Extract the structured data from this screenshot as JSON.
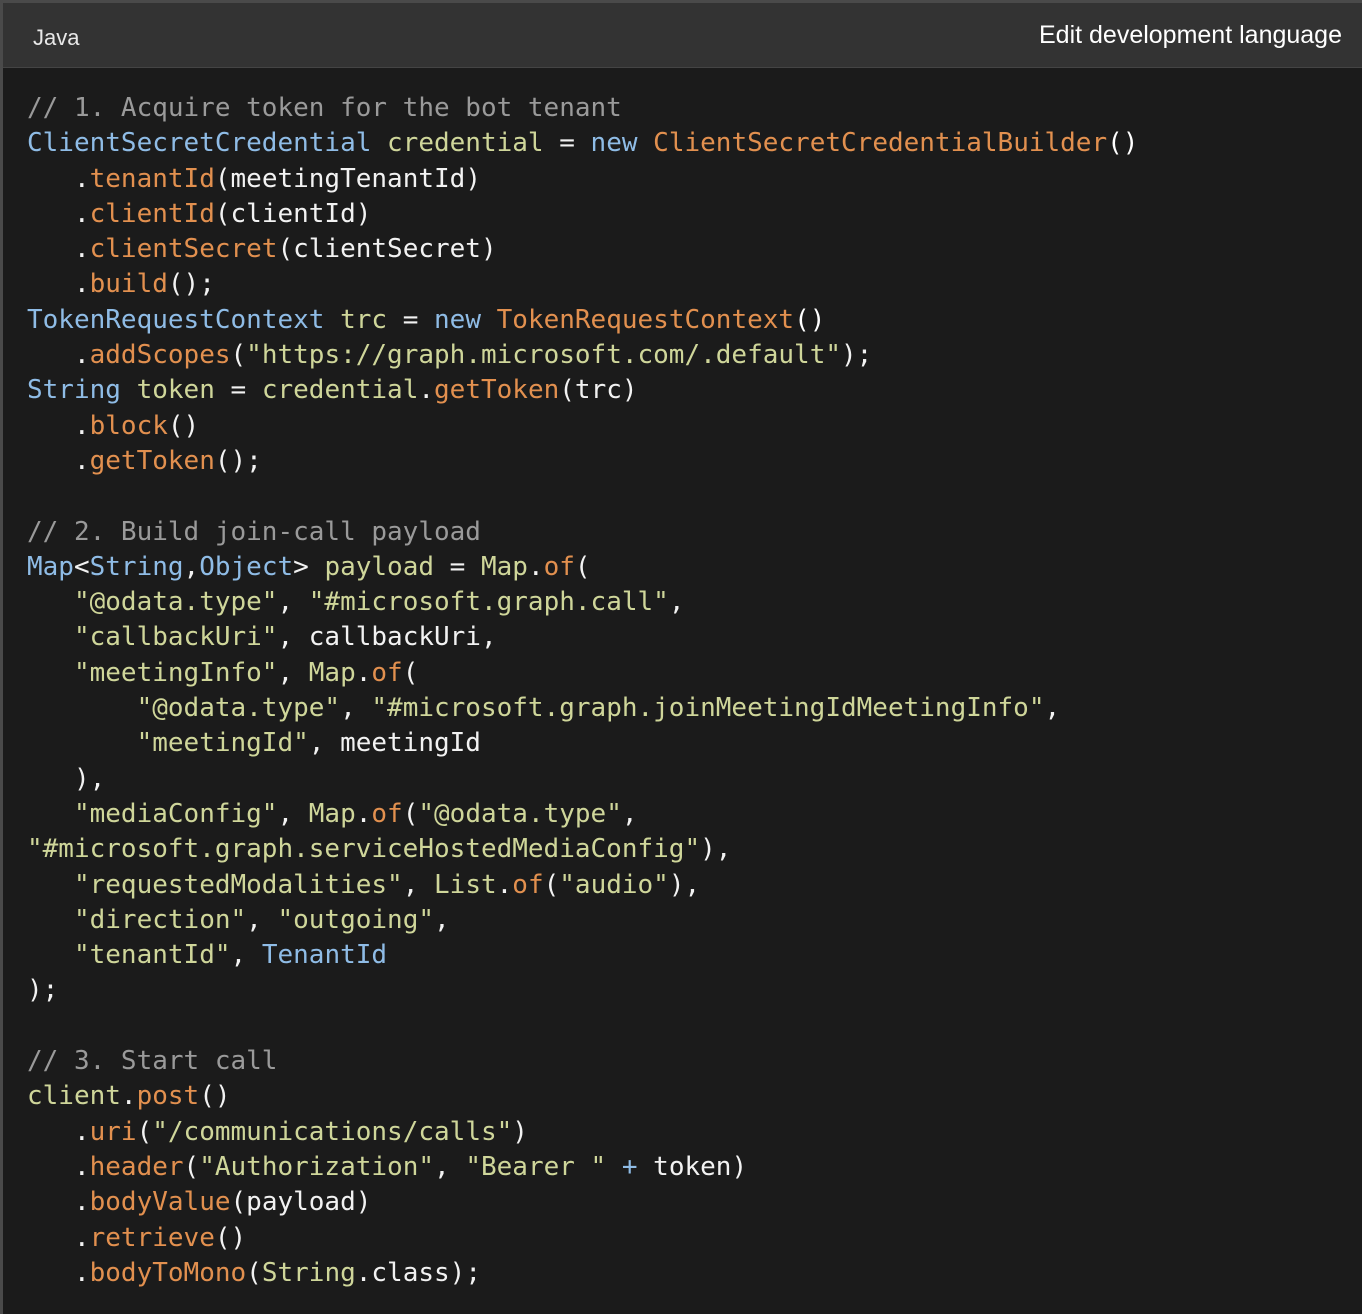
{
  "header": {
    "language": "Java",
    "edit_label": "Edit development language"
  },
  "colors": {
    "comment": "#9a9a9a",
    "type": "#8fbce6",
    "keyword": "#8fbce6",
    "method": "#e2904f",
    "variable": "#cfd69a",
    "string": "#cfd69a",
    "plain": "#f2f2f2",
    "punct": "#ffffff"
  },
  "code_lines": [
    [
      [
        "comment",
        "// 1. Acquire token for the bot tenant"
      ]
    ],
    [
      [
        "type",
        "ClientSecretCredential"
      ],
      [
        "plain",
        " "
      ],
      [
        "variable",
        "credential"
      ],
      [
        "plain",
        " = "
      ],
      [
        "keyword",
        "new"
      ],
      [
        "plain",
        " "
      ],
      [
        "method",
        "ClientSecretCredentialBuilder"
      ],
      [
        "punct",
        "()"
      ]
    ],
    [
      [
        "plain",
        "   ."
      ],
      [
        "method",
        "tenantId"
      ],
      [
        "plain",
        "(meetingTenantId)"
      ]
    ],
    [
      [
        "plain",
        "   ."
      ],
      [
        "method",
        "clientId"
      ],
      [
        "plain",
        "(clientId)"
      ]
    ],
    [
      [
        "plain",
        "   ."
      ],
      [
        "method",
        "clientSecret"
      ],
      [
        "plain",
        "(clientSecret)"
      ]
    ],
    [
      [
        "plain",
        "   ."
      ],
      [
        "method",
        "build"
      ],
      [
        "plain",
        "();"
      ]
    ],
    [
      [
        "type",
        "TokenRequestContext"
      ],
      [
        "plain",
        " "
      ],
      [
        "variable",
        "trc"
      ],
      [
        "plain",
        " = "
      ],
      [
        "keyword",
        "new"
      ],
      [
        "plain",
        " "
      ],
      [
        "method",
        "TokenRequestContext"
      ],
      [
        "punct",
        "()"
      ]
    ],
    [
      [
        "plain",
        "   ."
      ],
      [
        "method",
        "addScopes"
      ],
      [
        "plain",
        "("
      ],
      [
        "string",
        "\"https://graph.microsoft.com/.default\""
      ],
      [
        "plain",
        ");"
      ]
    ],
    [
      [
        "type",
        "String"
      ],
      [
        "plain",
        " "
      ],
      [
        "variable",
        "token"
      ],
      [
        "plain",
        " = "
      ],
      [
        "variable",
        "credential"
      ],
      [
        "plain",
        "."
      ],
      [
        "method",
        "getToken"
      ],
      [
        "plain",
        "(trc)"
      ]
    ],
    [
      [
        "plain",
        "   ."
      ],
      [
        "method",
        "block"
      ],
      [
        "plain",
        "()"
      ]
    ],
    [
      [
        "plain",
        "   ."
      ],
      [
        "method",
        "getToken"
      ],
      [
        "plain",
        "();"
      ]
    ],
    [],
    [
      [
        "comment",
        "// 2. Build join-call payload"
      ]
    ],
    [
      [
        "type",
        "Map"
      ],
      [
        "plain",
        "<"
      ],
      [
        "type",
        "String"
      ],
      [
        "plain",
        ","
      ],
      [
        "type",
        "Object"
      ],
      [
        "plain",
        "> "
      ],
      [
        "variable",
        "payload"
      ],
      [
        "plain",
        " = "
      ],
      [
        "variable",
        "Map"
      ],
      [
        "plain",
        "."
      ],
      [
        "method",
        "of"
      ],
      [
        "plain",
        "("
      ]
    ],
    [
      [
        "plain",
        "   "
      ],
      [
        "string",
        "\"@odata.type\""
      ],
      [
        "plain",
        ", "
      ],
      [
        "string",
        "\"#microsoft.graph.call\""
      ],
      [
        "plain",
        ","
      ]
    ],
    [
      [
        "plain",
        "   "
      ],
      [
        "string",
        "\"callbackUri\""
      ],
      [
        "plain",
        ", callbackUri,"
      ]
    ],
    [
      [
        "plain",
        "   "
      ],
      [
        "string",
        "\"meetingInfo\""
      ],
      [
        "plain",
        ", "
      ],
      [
        "variable",
        "Map"
      ],
      [
        "plain",
        "."
      ],
      [
        "method",
        "of"
      ],
      [
        "plain",
        "("
      ]
    ],
    [
      [
        "plain",
        "       "
      ],
      [
        "string",
        "\"@odata.type\""
      ],
      [
        "plain",
        ", "
      ],
      [
        "string",
        "\"#microsoft.graph.joinMeetingIdMeetingInfo\""
      ],
      [
        "plain",
        ","
      ]
    ],
    [
      [
        "plain",
        "       "
      ],
      [
        "string",
        "\"meetingId\""
      ],
      [
        "plain",
        ", meetingId"
      ]
    ],
    [
      [
        "plain",
        "   ),"
      ]
    ],
    [
      [
        "plain",
        "   "
      ],
      [
        "string",
        "\"mediaConfig\""
      ],
      [
        "plain",
        ", "
      ],
      [
        "variable",
        "Map"
      ],
      [
        "plain",
        "."
      ],
      [
        "method",
        "of"
      ],
      [
        "plain",
        "("
      ],
      [
        "string",
        "\"@odata.type\""
      ],
      [
        "plain",
        ","
      ]
    ],
    [
      [
        "string",
        "\"#microsoft.graph.serviceHostedMediaConfig\""
      ],
      [
        "plain",
        "),"
      ]
    ],
    [
      [
        "plain",
        "   "
      ],
      [
        "string",
        "\"requestedModalities\""
      ],
      [
        "plain",
        ", "
      ],
      [
        "variable",
        "List"
      ],
      [
        "plain",
        "."
      ],
      [
        "method",
        "of"
      ],
      [
        "plain",
        "("
      ],
      [
        "string",
        "\"audio\""
      ],
      [
        "plain",
        "),"
      ]
    ],
    [
      [
        "plain",
        "   "
      ],
      [
        "string",
        "\"direction\""
      ],
      [
        "plain",
        ", "
      ],
      [
        "string",
        "\"outgoing\""
      ],
      [
        "plain",
        ","
      ]
    ],
    [
      [
        "plain",
        "   "
      ],
      [
        "string",
        "\"tenantId\""
      ],
      [
        "plain",
        ", "
      ],
      [
        "type",
        "TenantId"
      ]
    ],
    [
      [
        "plain",
        ");"
      ]
    ],
    [],
    [
      [
        "comment",
        "// 3. Start call"
      ]
    ],
    [
      [
        "variable",
        "client"
      ],
      [
        "plain",
        "."
      ],
      [
        "method",
        "post"
      ],
      [
        "plain",
        "()"
      ]
    ],
    [
      [
        "plain",
        "   ."
      ],
      [
        "method",
        "uri"
      ],
      [
        "plain",
        "("
      ],
      [
        "string",
        "\"/communications/calls\""
      ],
      [
        "plain",
        ")"
      ]
    ],
    [
      [
        "plain",
        "   ."
      ],
      [
        "method",
        "header"
      ],
      [
        "plain",
        "("
      ],
      [
        "string",
        "\"Authorization\""
      ],
      [
        "plain",
        ", "
      ],
      [
        "string",
        "\"Bearer \""
      ],
      [
        "plain",
        " "
      ],
      [
        "type",
        "+"
      ],
      [
        "plain",
        " token)"
      ]
    ],
    [
      [
        "plain",
        "   ."
      ],
      [
        "method",
        "bodyValue"
      ],
      [
        "plain",
        "(payload)"
      ]
    ],
    [
      [
        "plain",
        "   ."
      ],
      [
        "method",
        "retrieve"
      ],
      [
        "plain",
        "()"
      ]
    ],
    [
      [
        "plain",
        "   ."
      ],
      [
        "method",
        "bodyToMono"
      ],
      [
        "plain",
        "("
      ],
      [
        "variable",
        "String"
      ],
      [
        "plain",
        ".class);"
      ]
    ]
  ]
}
